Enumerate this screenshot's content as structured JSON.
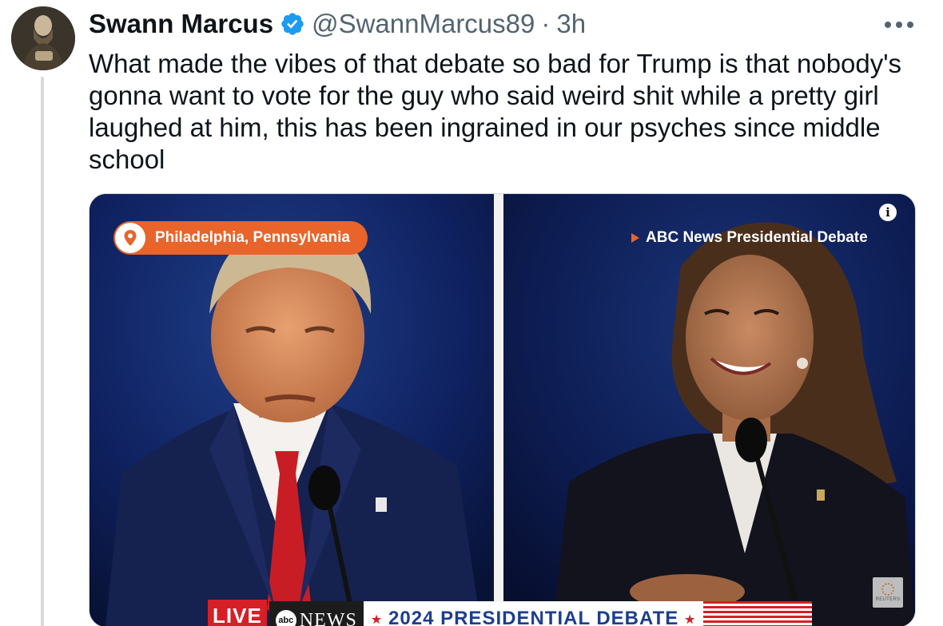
{
  "author": {
    "display_name": "Swann Marcus",
    "handle": "@SwannMarcus89",
    "separator": "·",
    "time": "3h",
    "verified": true,
    "avatar_icon": "portrait-avatar"
  },
  "tweet": {
    "text": "What made the vibes of that debate so bad for Trump is that nobody's gonna want to vote for the guy who said weird shit while a pretty girl laughed at him, this has been ingrained in our psyches since middle school"
  },
  "media": {
    "location_label": "Philadelphia, Pennsylvania",
    "broadcast_label": "ABC News Presidential Debate",
    "info_glyph": "i",
    "watermark": "REUTERS",
    "chyron": {
      "live": "LIVE",
      "network_logo": "abc",
      "network": "NEWS",
      "star": "★",
      "title": "2024 PRESIDENTIAL DEBATE"
    }
  },
  "colors": {
    "verified_blue": "#1d9bf0",
    "secondary_text": "#536471",
    "location_orange": "#e8642a",
    "backdrop_navy": "#0c1a44"
  },
  "icons": {
    "more": "more-horizontal-icon",
    "verified": "verified-badge-icon",
    "pin": "location-pin-icon",
    "info": "info-icon",
    "play": "play-triangle-icon"
  }
}
